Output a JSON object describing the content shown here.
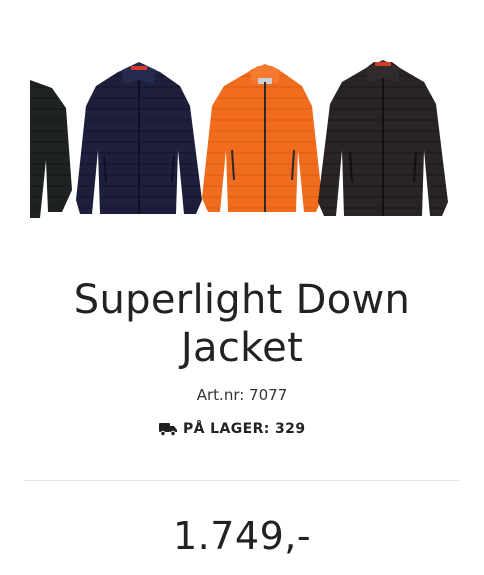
{
  "product": {
    "title_line1": "Superlight Down",
    "title_line2": "Jacket",
    "art_nr": "Art.nr: 7077",
    "stock_label": "PÅ LAGER: 329",
    "price": "1.749,-"
  },
  "gallery": {
    "jackets": [
      {
        "color_name": "black",
        "color": "#1f2320"
      },
      {
        "color_name": "navy",
        "color": "#1d1f3d"
      },
      {
        "color_name": "orange",
        "color": "#f26c1e"
      },
      {
        "color_name": "black",
        "color": "#2a2424"
      }
    ]
  },
  "icons": {
    "stock": "truck-icon"
  }
}
